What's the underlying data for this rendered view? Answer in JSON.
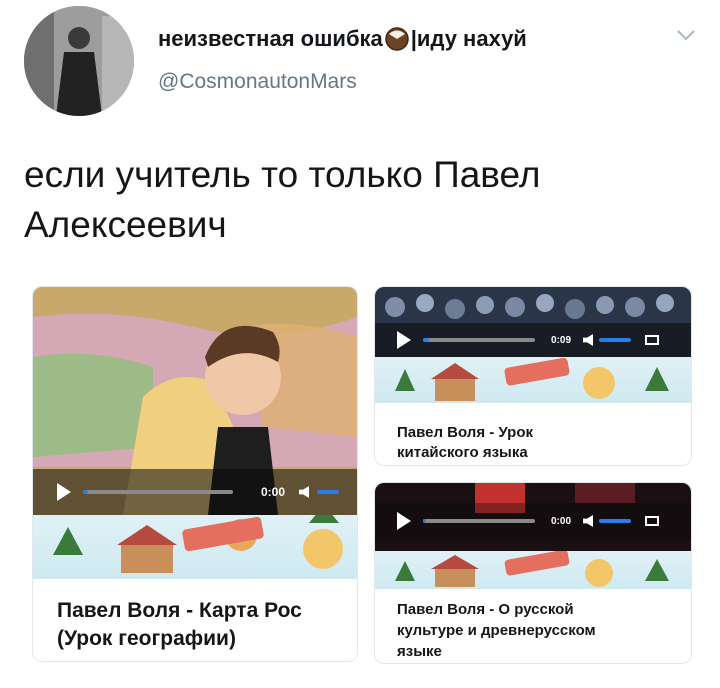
{
  "tweet": {
    "display_name_before": "неизвестная ошибка",
    "display_name_after": "|иду нахуй",
    "handle": "@CosmonautonMars",
    "text": "если учитель то только Павел Алексеевич"
  },
  "cards": [
    {
      "title": "Павел Воля - Карта Рос\n(Урок географии)",
      "time": "0:00",
      "progress": 0.03
    },
    {
      "title": "Павел Воля - Урок\nкитайского языка",
      "time": "0:09",
      "progress": 0.05
    },
    {
      "title": "Павел Воля - О русской\nкультуре и древнерусском\nязыке",
      "time": "0:00",
      "progress": 0.03
    }
  ],
  "icons": {
    "avatar": "user-avatar",
    "name_emoji": "coconut-icon",
    "menu": "chevron-down-icon",
    "play": "play-icon",
    "volume": "volume-icon",
    "fullscreen": "fullscreen-icon"
  },
  "colors": {
    "text": "#14171a",
    "secondary": "#657786",
    "player_accent": "#2a7ee8"
  }
}
